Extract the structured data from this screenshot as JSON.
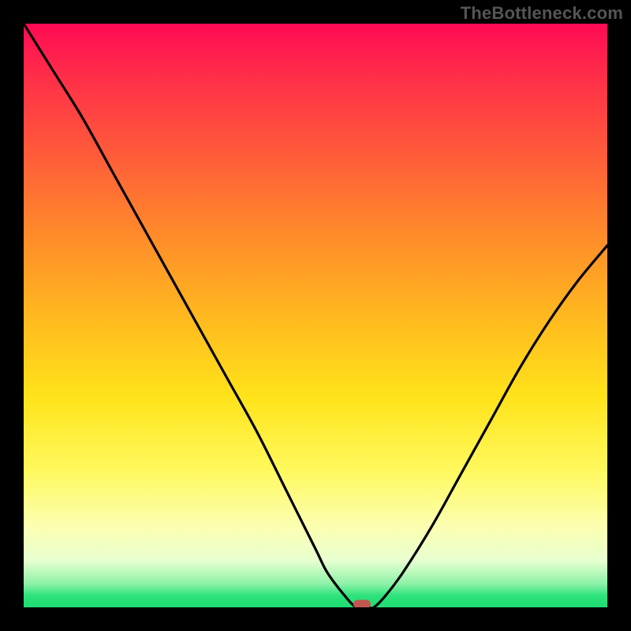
{
  "watermark": "TheBottleneck.com",
  "chart_data": {
    "type": "line",
    "x": [
      0.0,
      0.05,
      0.1,
      0.15,
      0.2,
      0.25,
      0.3,
      0.35,
      0.4,
      0.45,
      0.5,
      0.52,
      0.55,
      0.57,
      0.59,
      0.6,
      0.62,
      0.65,
      0.7,
      0.75,
      0.8,
      0.85,
      0.9,
      0.95,
      1.0
    ],
    "y": [
      1.0,
      0.92,
      0.84,
      0.75,
      0.66,
      0.57,
      0.48,
      0.39,
      0.3,
      0.2,
      0.1,
      0.06,
      0.02,
      0.0,
      0.0,
      0.0,
      0.02,
      0.06,
      0.14,
      0.23,
      0.32,
      0.41,
      0.49,
      0.56,
      0.62
    ],
    "title": "",
    "xlabel": "",
    "ylabel": "",
    "xlim": [
      0,
      1
    ],
    "ylim": [
      0,
      1
    ],
    "trough_x": 0.58,
    "trough_y": 0.0,
    "series": [
      {
        "name": "bottleneck-curve",
        "color": "#000000"
      }
    ],
    "background_gradient": {
      "top": "#ff0a54",
      "mid_upper": "#ff8a2a",
      "mid": "#ffe31a",
      "mid_lower": "#fcffb0",
      "bottom": "#1edc73"
    },
    "marker": {
      "shape": "pill",
      "color": "#c0564f"
    }
  }
}
